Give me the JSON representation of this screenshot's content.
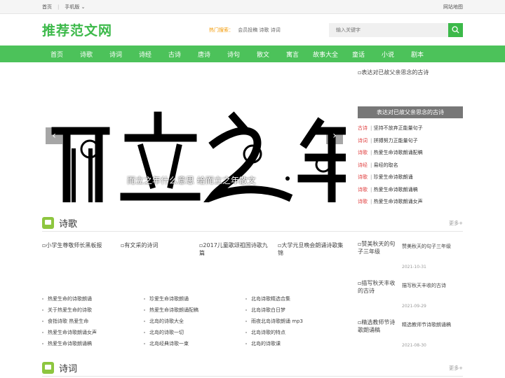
{
  "topbar": {
    "home": "首页",
    "mobile": "手机版",
    "sitemap": "网站地图"
  },
  "header": {
    "logo": "推荐范文网",
    "hot_label": "热门搜索：",
    "hot_links": "会员投稿 诗歌 诗词",
    "search_placeholder": "输入关键字",
    "search_icon": "search-icon"
  },
  "nav": [
    "首页",
    "诗歌",
    "诗词",
    "诗经",
    "古诗",
    "唐诗",
    "诗句",
    "散文",
    "寓言",
    "故事大全",
    "童话",
    "小说",
    "剧本"
  ],
  "slider": {
    "caption": "而立之年什么意思 给而立之年散文",
    "prev": "‹",
    "next": "›",
    "art_chars": [
      "而",
      "立",
      "之",
      "年"
    ]
  },
  "side": {
    "image_alt": "表达对已故父亲思念的古诗",
    "bar_title": "表达对已故父亲思念的古诗",
    "items": [
      {
        "cat": "古诗",
        "title": "坚持不放弃正能量句子"
      },
      {
        "cat": "诗词",
        "title": "拼搏努力正能量句子"
      },
      {
        "cat": "诗歌",
        "title": "热爱生命诗歌朗诵配稿"
      },
      {
        "cat": "诗经",
        "title": "易经的取名"
      },
      {
        "cat": "诗歌",
        "title": "珍爱生命诗歌朗诵"
      },
      {
        "cat": "诗歌",
        "title": "热爱生命诗歌朗诵稿"
      },
      {
        "cat": "诗歌",
        "title": "热爱生命诗歌朗诵女声"
      }
    ]
  },
  "section1": {
    "title": "诗歌",
    "more": "更多+"
  },
  "section2": {
    "title": "诗词",
    "more": "更多+"
  },
  "thumbs": [
    "小学生尊敬师长黑板报",
    "有文采的诗词",
    "2017儿童歌颂祖国诗歌九篇",
    "大学元旦晚会朗诵诗歌集锦"
  ],
  "lists": [
    [
      "热爱生命的诗歌朗诵",
      "关于热爱生命的诗歌",
      "食指诗歌 热爱生命",
      "热爱生命诗歌朗诵女声",
      "热爱生命诗歌朗诵稿"
    ],
    [
      "珍爱生命诗歌朗诵",
      "热爱生命诗歌朗诵配稿",
      "北岛的诗歌大全",
      "北岛的诗歌一切",
      "北岛经典诗歌一束"
    ],
    [
      "北岛诗歌精选合集",
      "北岛诗歌白日梦",
      "雨夜北岛诗歌朗诵 mp3",
      "北岛诗歌的特点",
      "北岛的诗歌课"
    ]
  ],
  "rcards": [
    {
      "img": "赞美秋天的句子三年级",
      "title": "赞美秋天的句子三年级",
      "date": "2021-10-31"
    },
    {
      "img": "描写秋天丰收的古诗",
      "title": "描写秋天丰收的古诗",
      "date": "2021-09-29"
    },
    {
      "img": "精选教师节诗歌朗诵稿",
      "title": "精选教师节诗歌朗诵稿",
      "date": "2021-08-30"
    }
  ]
}
